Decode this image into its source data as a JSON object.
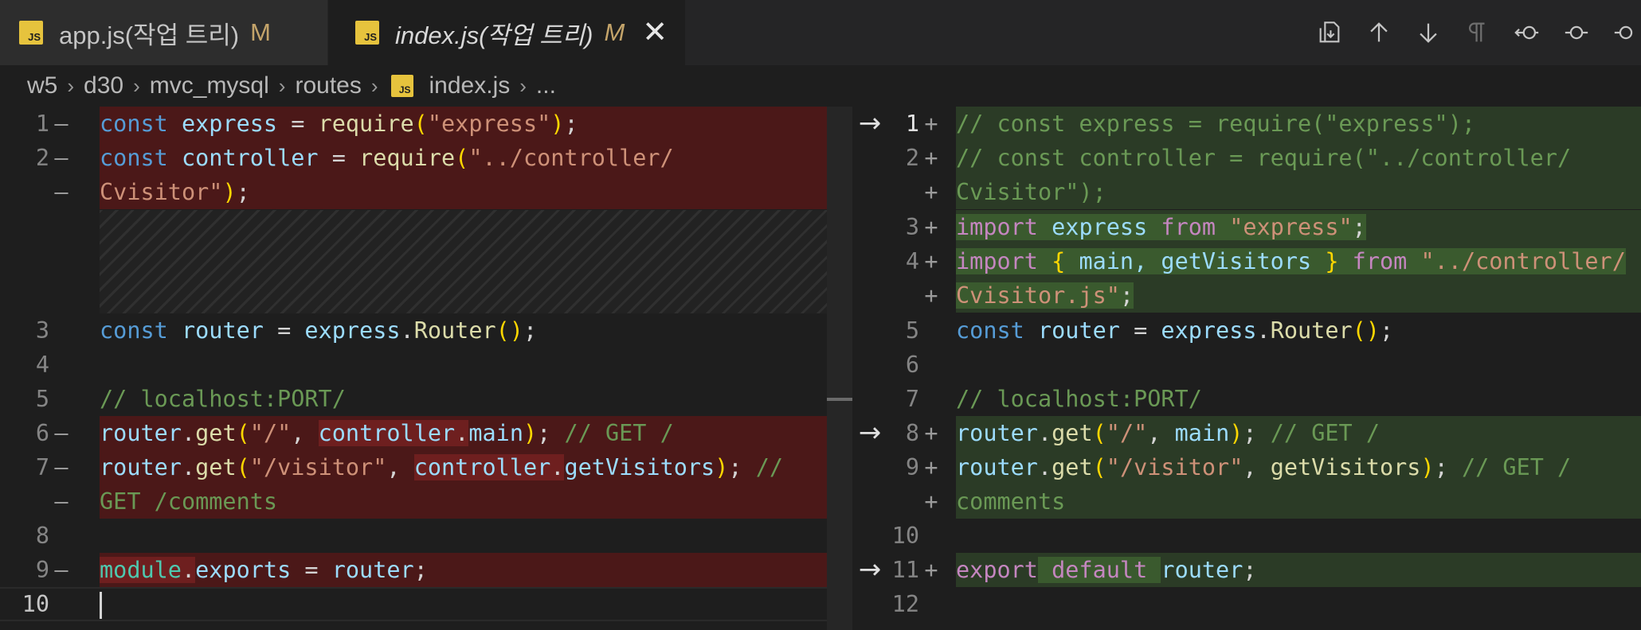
{
  "tabs": [
    {
      "label": "app.js(작업 트리)",
      "status": "M",
      "icon": "js-file-icon"
    },
    {
      "label": "index.js(작업 트리)",
      "status": "M",
      "icon": "js-file-icon",
      "close": "✕"
    }
  ],
  "toolbar": [
    "open-file-icon",
    "previous-change-icon",
    "next-change-icon",
    "toggle-whitespace-icon",
    "revert-icon",
    "inline-view-icon",
    "more-icon"
  ],
  "breadcrumb": [
    "w5",
    "d30",
    "mvc_mysql",
    "routes",
    "index.js",
    "..."
  ],
  "left": {
    "line_numbers": [
      "1",
      "2",
      "3",
      "4",
      "5",
      "6",
      "7",
      "8",
      "9",
      "10"
    ],
    "markers": {
      "minus": "—"
    }
  },
  "right": {
    "line_numbers": [
      "1",
      "2",
      "3",
      "4",
      "5",
      "6",
      "7",
      "8",
      "9",
      "10",
      "11",
      "12"
    ],
    "markers": {
      "plus": "+"
    }
  },
  "code_left": {
    "l1": [
      "const",
      " ",
      "express",
      " = ",
      "require",
      "(",
      "\"express\"",
      ")",
      ";"
    ],
    "l2": [
      "const",
      " ",
      "controller",
      " = ",
      "require",
      "(",
      "\"../controller/"
    ],
    "l2b": [
      "Cvisitor\"",
      ")",
      ";"
    ],
    "l3": [
      "const",
      " ",
      "router",
      " = ",
      "express",
      ".",
      "Router",
      "()",
      ";"
    ],
    "l5": [
      "// localhost:PORT/"
    ],
    "l6": [
      "router",
      ".",
      "get",
      "(",
      "\"/\"",
      ", ",
      "controller",
      ".",
      "main",
      ")",
      "; ",
      "// GET /"
    ],
    "l7": [
      "router",
      ".",
      "get",
      "(",
      "\"/visitor\"",
      ", ",
      "controller",
      ".",
      "getVisitors",
      ")",
      "; ",
      "//"
    ],
    "l7b": [
      "GET /comments"
    ],
    "l9": [
      "module",
      ".",
      "exports",
      " = ",
      "router",
      ";"
    ]
  },
  "code_right": {
    "r1": [
      "// const express = require(\"express\");"
    ],
    "r2": [
      "// const controller = require(\"../controller/"
    ],
    "r2b": [
      "Cvisitor\");"
    ],
    "r3": [
      "import",
      " ",
      "express",
      " ",
      "from",
      " ",
      "\"express\"",
      ";"
    ],
    "r4": [
      "import",
      " ",
      "{",
      " main, ",
      "getVisitors",
      " ",
      "}",
      " ",
      "from",
      " ",
      "\"../controller/"
    ],
    "r4b": [
      "Cvisitor.js\"",
      ";"
    ],
    "r5": [
      "const",
      " ",
      "router",
      " = ",
      "express",
      ".",
      "Router",
      "()",
      ";"
    ],
    "r7": [
      "// localhost:PORT/"
    ],
    "r8": [
      "router",
      ".",
      "get",
      "(",
      "\"/\"",
      ", ",
      "main",
      ")",
      "; ",
      "// GET /"
    ],
    "r9": [
      "router",
      ".",
      "get",
      "(",
      "\"/visitor\"",
      ", ",
      "getVisitors",
      ")",
      "; ",
      "// GET /"
    ],
    "r9b": [
      "comments"
    ],
    "r11": [
      "export",
      " ",
      "default",
      " ",
      "router",
      ";"
    ]
  },
  "arrows": [
    "→",
    "→",
    "→"
  ],
  "colors": {
    "deleted_bg": "#4b1818",
    "inserted_bg": "#2b3b26",
    "keyword": "#569cd6",
    "string": "#ce9178",
    "comment": "#6a9955"
  }
}
